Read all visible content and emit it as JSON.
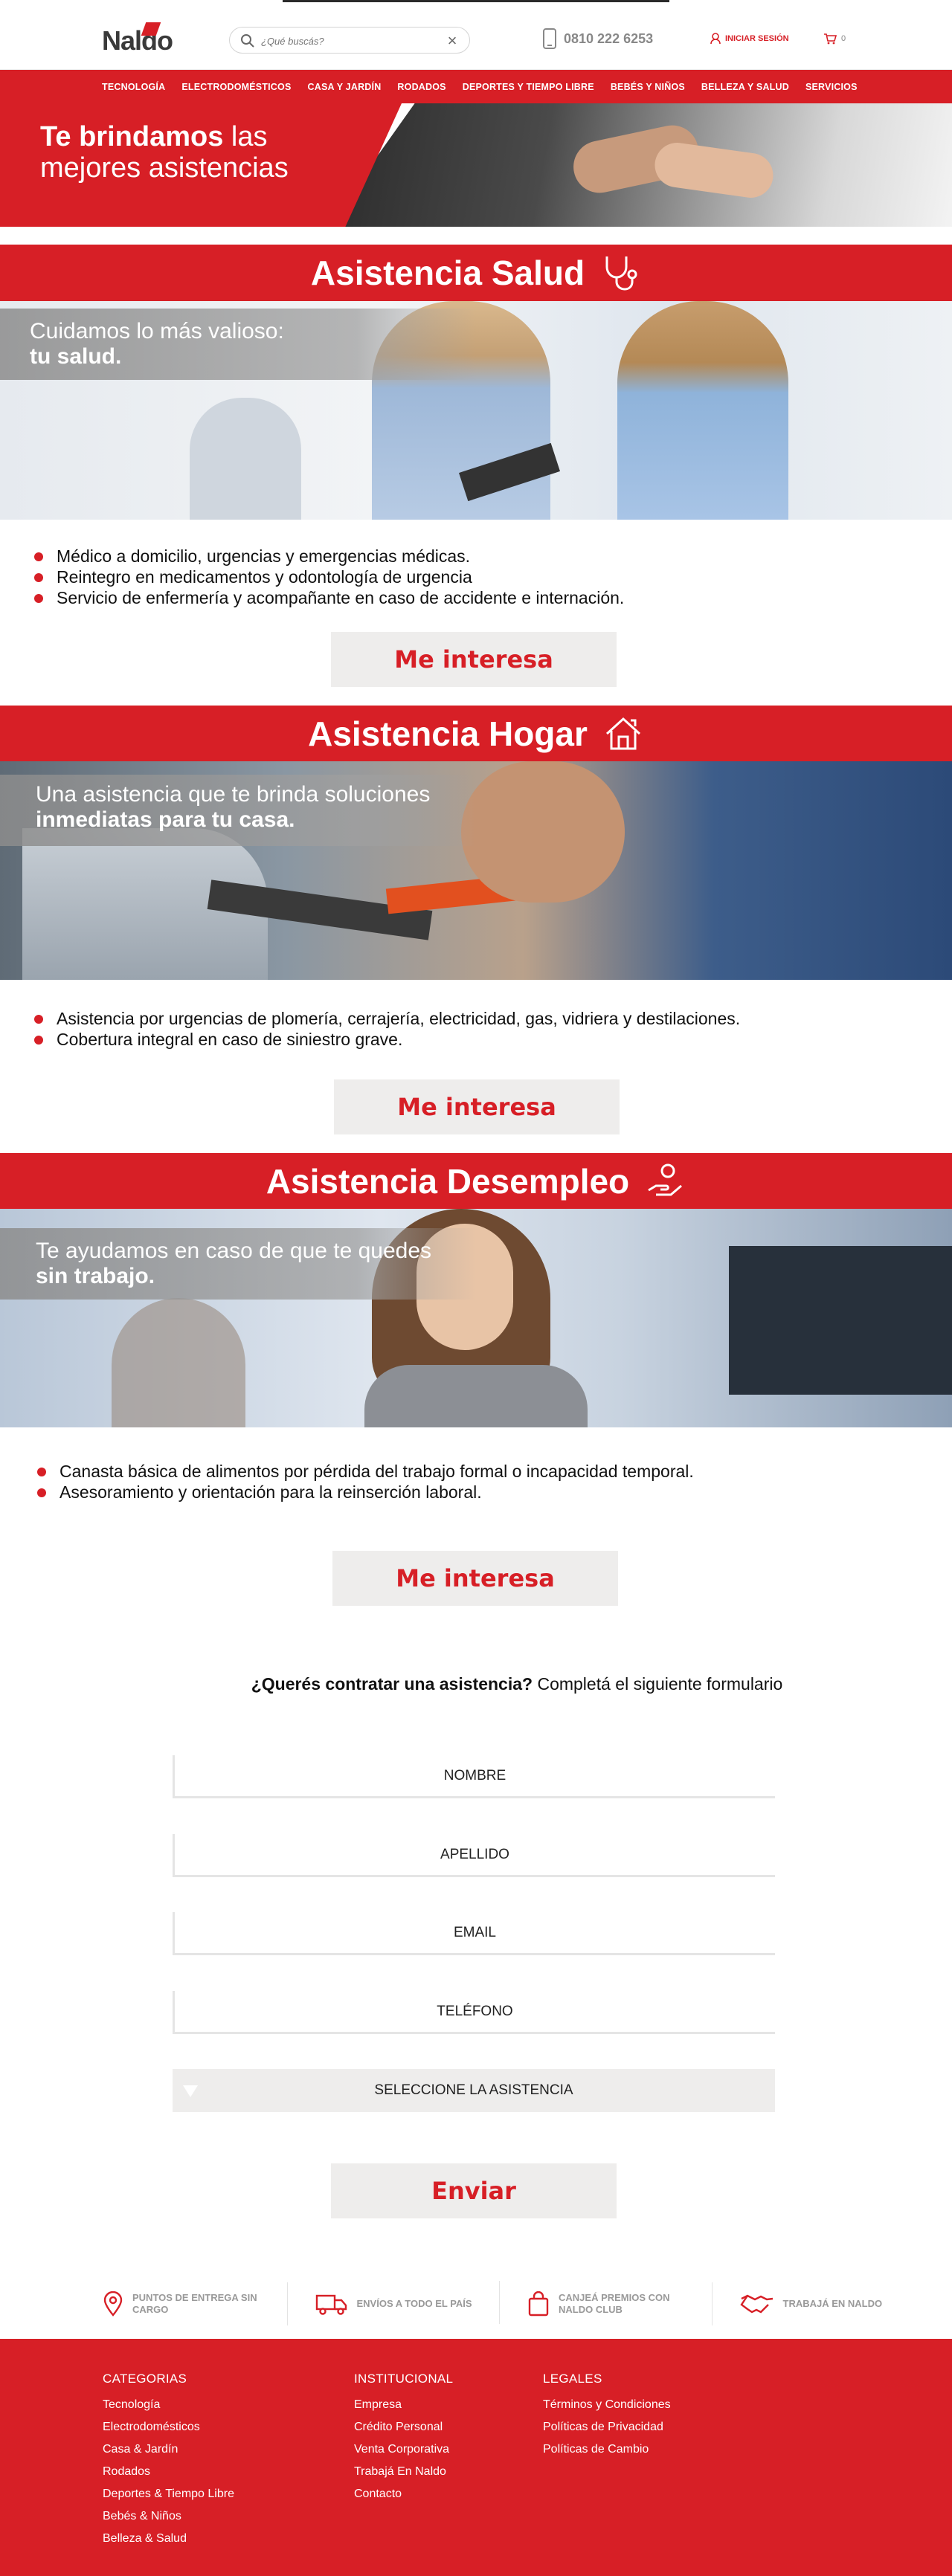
{
  "header": {
    "logo_text": "Naldo",
    "search_placeholder": "¿Qué buscás?",
    "phone": "0810 222 6253",
    "login_label": "INICIAR SESIÓN",
    "cart_count": "0"
  },
  "nav": {
    "items": [
      "TECNOLOGÍA",
      "ELECTRODOMÉSTICOS",
      "CASA Y JARDÍN",
      "RODADOS",
      "DEPORTES Y TIEMPO LIBRE",
      "BEBÉS Y NIÑOS",
      "BELLEZA Y SALUD",
      "SERVICIOS"
    ]
  },
  "hero": {
    "title_bold": "Te brindamos",
    "title_rest": " las mejores asistencias"
  },
  "sections": [
    {
      "title": "Asistencia Salud",
      "caption_light": "Cuidamos lo más valioso:",
      "caption_bold": "tu salud.",
      "items": [
        "Médico a domicilio, urgencias y emergencias médicas.",
        "Reintegro en medicamentos y odontología de urgencia",
        "Servicio de enfermería y acompañante en caso de accidente e internación."
      ],
      "cta": "Me interesa"
    },
    {
      "title": "Asistencia Hogar",
      "caption_light": "Una asistencia que te brinda soluciones",
      "caption_bold": "inmediatas para tu casa.",
      "items": [
        "Asistencia por urgencias de plomería, cerrajería, electricidad, gas, vidriera y destilaciones.",
        "Cobertura integral en caso de siniestro grave."
      ],
      "cta": "Me interesa"
    },
    {
      "title": "Asistencia Desempleo",
      "caption_light": "Te ayudamos en caso de que te quedes",
      "caption_bold": "sin trabajo.",
      "items": [
        "Canasta básica de alimentos por pérdida del trabajo formal o incapacidad temporal.",
        "Asesoramiento y orientación para la reinserción laboral."
      ],
      "cta": "Me interesa"
    }
  ],
  "form": {
    "lead_bold": "¿Querés contratar una asistencia?",
    "lead_rest": " Completá el siguiente formulario",
    "fields": [
      "NOMBRE",
      "APELLIDO",
      "EMAIL",
      "TELÉFONO"
    ],
    "select_label": "SELECCIONE LA ASISTENCIA",
    "submit": "Enviar"
  },
  "benefits": [
    {
      "icon": "location-pin-icon",
      "text": "PUNTOS DE ENTREGA SIN CARGO"
    },
    {
      "icon": "truck-icon",
      "text": "ENVÍOS A TODO EL PAÍS"
    },
    {
      "icon": "shopping-bag-icon",
      "text": "CANJEÁ PREMIOS CON NALDO CLUB"
    },
    {
      "icon": "handshake-icon",
      "text": "TRABAJÁ EN NALDO"
    }
  ],
  "footer": {
    "categorias": {
      "title": "CATEGORIAS",
      "links": [
        "Tecnología",
        "Electrodomésticos",
        "Casa & Jardín",
        "Rodados",
        "Deportes & Tiempo Libre",
        "Bebés & Niños",
        "Belleza & Salud"
      ]
    },
    "institucional": {
      "title": "INSTITUCIONAL",
      "links": [
        "Empresa",
        "Crédito Personal",
        "Venta Corporativa",
        "Trabajá En Naldo",
        "Contacto"
      ]
    },
    "legales": {
      "title": "LEGALES",
      "links": [
        "Términos y Condiciones",
        "Políticas de Privacidad",
        "Políticas de Cambio"
      ]
    }
  },
  "colors": {
    "brand_red": "#d71f26",
    "button_bg": "#eeedec",
    "grey_text": "#999999"
  }
}
